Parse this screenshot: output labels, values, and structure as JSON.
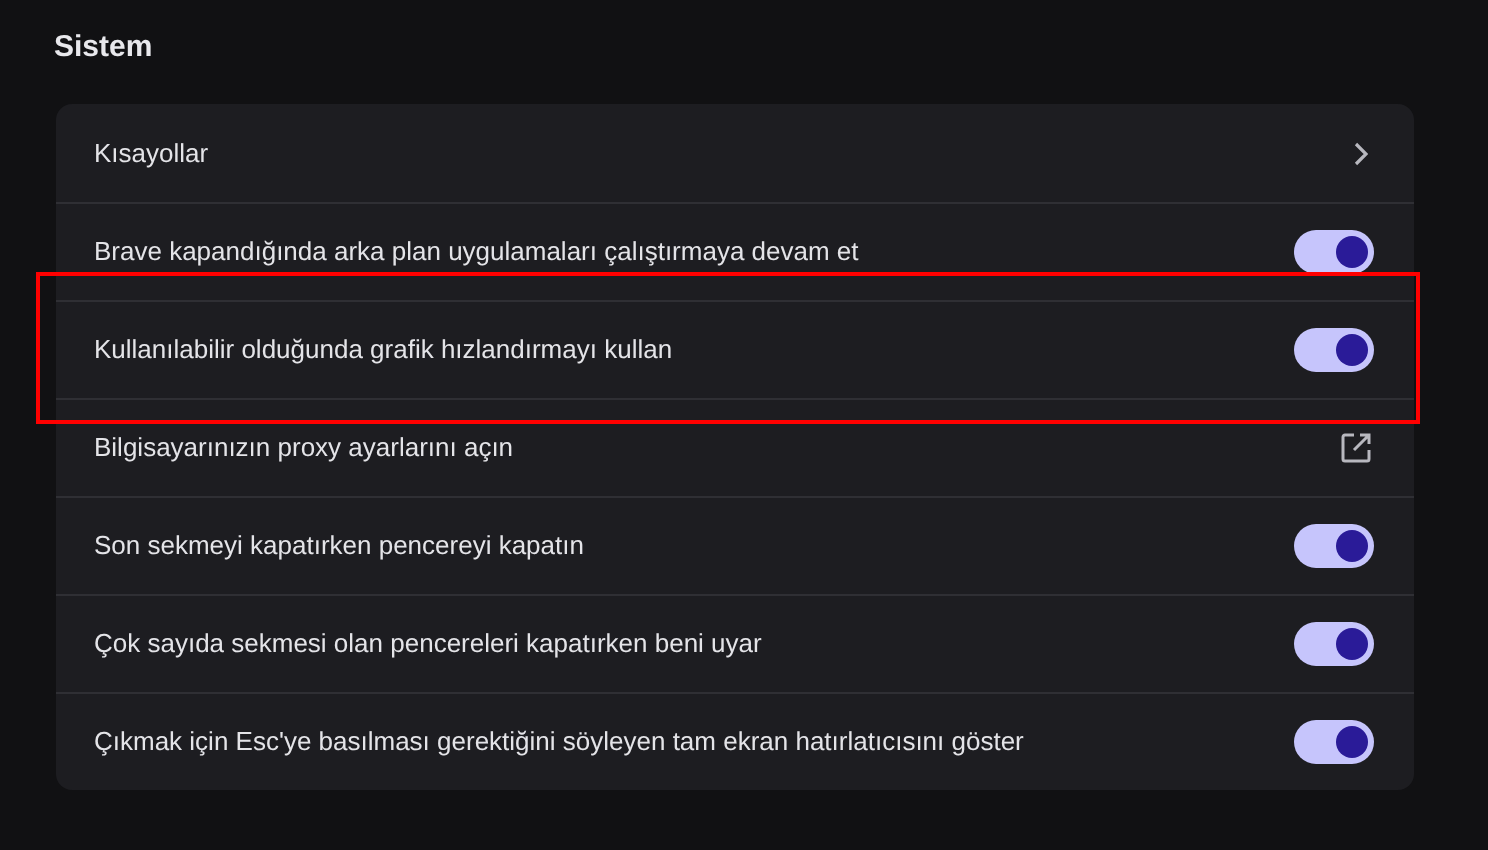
{
  "section": {
    "title": "Sistem"
  },
  "rows": [
    {
      "kind": "link",
      "label": "Kısayollar",
      "highlighted": false
    },
    {
      "kind": "toggle",
      "label": "Brave kapandığında arka plan uygulamaları çalıştırmaya devam et",
      "on": true,
      "highlighted": false
    },
    {
      "kind": "toggle",
      "label": "Kullanılabilir olduğunda grafik hızlandırmayı kullan",
      "on": true,
      "highlighted": true
    },
    {
      "kind": "external",
      "label": "Bilgisayarınızın proxy ayarlarını açın",
      "highlighted": false
    },
    {
      "kind": "toggle",
      "label": "Son sekmeyi kapatırken pencereyi kapatın",
      "on": true,
      "highlighted": false
    },
    {
      "kind": "toggle",
      "label": "Çok sayıda sekmesi olan pencereleri kapatırken beni uyar",
      "on": true,
      "highlighted": false
    },
    {
      "kind": "toggle",
      "label": "Çıkmak için Esc'ye basılması gerektiğini söyleyen tam ekran hatırlatıcısını göster",
      "on": true,
      "highlighted": false
    }
  ]
}
